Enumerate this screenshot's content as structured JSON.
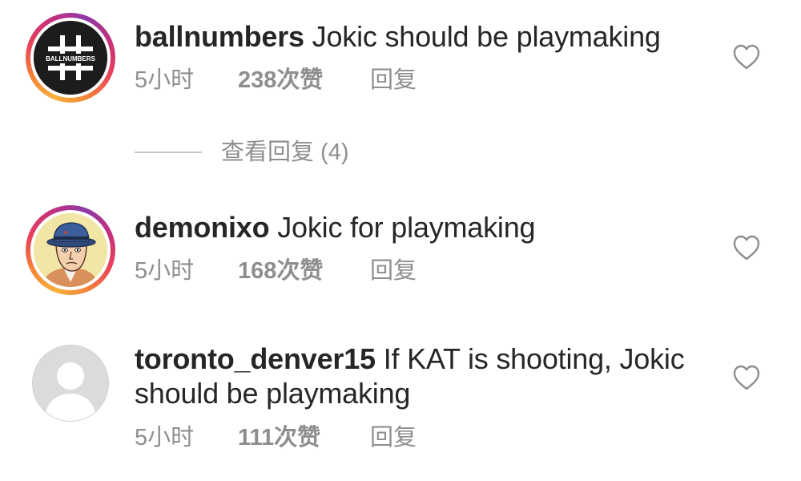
{
  "comments": [
    {
      "username": "ballnumbers",
      "text": "Jokic should be playmaking",
      "time": "5小时",
      "likes": "238次赞",
      "reply_label": "回复",
      "avatar_logo_text": "BALLNUMBERS",
      "like_icon": "heart-outline-icon"
    },
    {
      "username": "demonixo",
      "text": "Jokic for playmaking",
      "time": "5小时",
      "likes": "168次赞",
      "reply_label": "回复",
      "like_icon": "heart-outline-icon"
    },
    {
      "username": "toronto_denver15",
      "text_line1": "If KAT is shooting, Jokic",
      "text_line2": "should be playmaking",
      "time": "5小时",
      "likes": "111次赞",
      "reply_label": "回复",
      "like_icon": "heart-outline-icon"
    }
  ],
  "view_replies": {
    "label": "查看回复 (4)"
  },
  "colors": {
    "text_primary": "#262626",
    "text_secondary": "#8e8e8e",
    "story_ring_start": "#f7b23b",
    "story_ring_end": "#c2307c"
  }
}
